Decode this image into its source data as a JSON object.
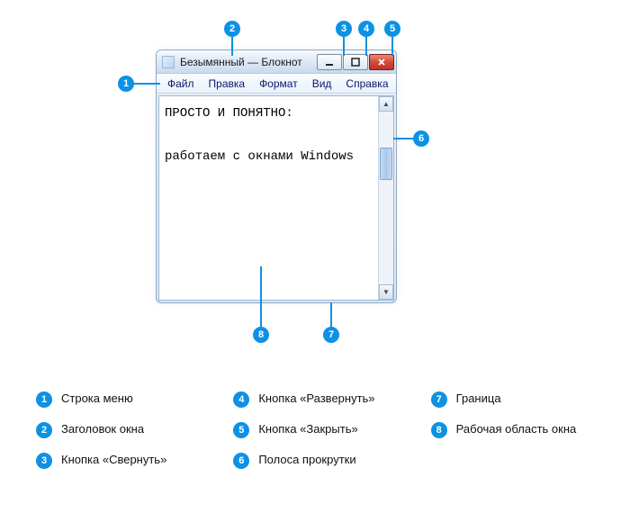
{
  "colors": {
    "accent": "#0d91e4",
    "close_button": "#c23224"
  },
  "window": {
    "title": "Безымянный — Блокнот",
    "menu": [
      "Файл",
      "Правка",
      "Формат",
      "Вид",
      "Справка"
    ],
    "content_line1": "ПРОСТО И ПОНЯТНО:",
    "content_line2": "работаем с окнами Windows"
  },
  "callouts": {
    "c1": "1",
    "c2": "2",
    "c3": "3",
    "c4": "4",
    "c5": "5",
    "c6": "6",
    "c7": "7",
    "c8": "8"
  },
  "legend": [
    {
      "num": "1",
      "text": "Строка меню"
    },
    {
      "num": "2",
      "text": "Заголовок окна"
    },
    {
      "num": "3",
      "text": "Кнопка «Свернуть»"
    },
    {
      "num": "4",
      "text": "Кнопка «Развернуть»"
    },
    {
      "num": "5",
      "text": "Кнопка «Закрыть»"
    },
    {
      "num": "6",
      "text": "Полоса прокрутки"
    },
    {
      "num": "7",
      "text": "Граница"
    },
    {
      "num": "8",
      "text": "Рабочая область окна"
    }
  ]
}
